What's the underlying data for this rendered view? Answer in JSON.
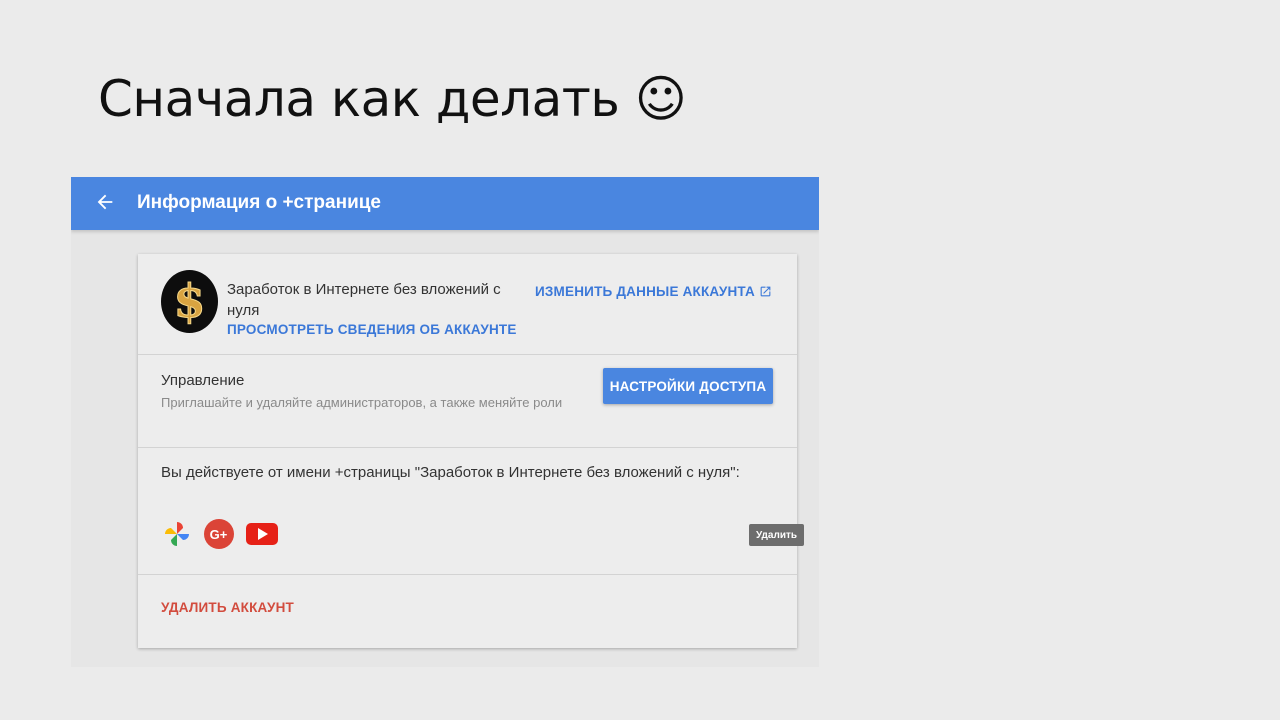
{
  "slide": {
    "title": "Сначала как делать ☺"
  },
  "topbar": {
    "title": "Информация о +странице",
    "back_icon": "arrow-left-icon"
  },
  "account": {
    "avatar_symbol": "$",
    "name": "Заработок в Интернете без вложений с нуля",
    "view_link": "ПРОСМОТРЕТЬ СВЕДЕНИЯ ОБ АККАУНТЕ",
    "edit_link": "ИЗМЕНИТЬ ДАННЫЕ АККАУНТА",
    "edit_link_icon": "open-in-new-icon"
  },
  "management": {
    "title": "Управление",
    "description": "Приглашайте и удаляйте администраторов, а также меняйте роли",
    "button": "НАСТРОЙКИ ДОСТУПА"
  },
  "acting": {
    "text": "Вы действуете от имени +страницы \"Заработок в Интернете без вложений с нуля\":",
    "services": [
      "google-photos-icon",
      "google-plus-icon",
      "youtube-icon"
    ],
    "tooltip": "Удалить"
  },
  "delete": {
    "label": "УДАЛИТЬ АККАУНТ"
  },
  "colors": {
    "topbar": "#4a86e0",
    "link": "#3b78d8",
    "danger": "#d24c3e",
    "background": "#ebebeb"
  }
}
